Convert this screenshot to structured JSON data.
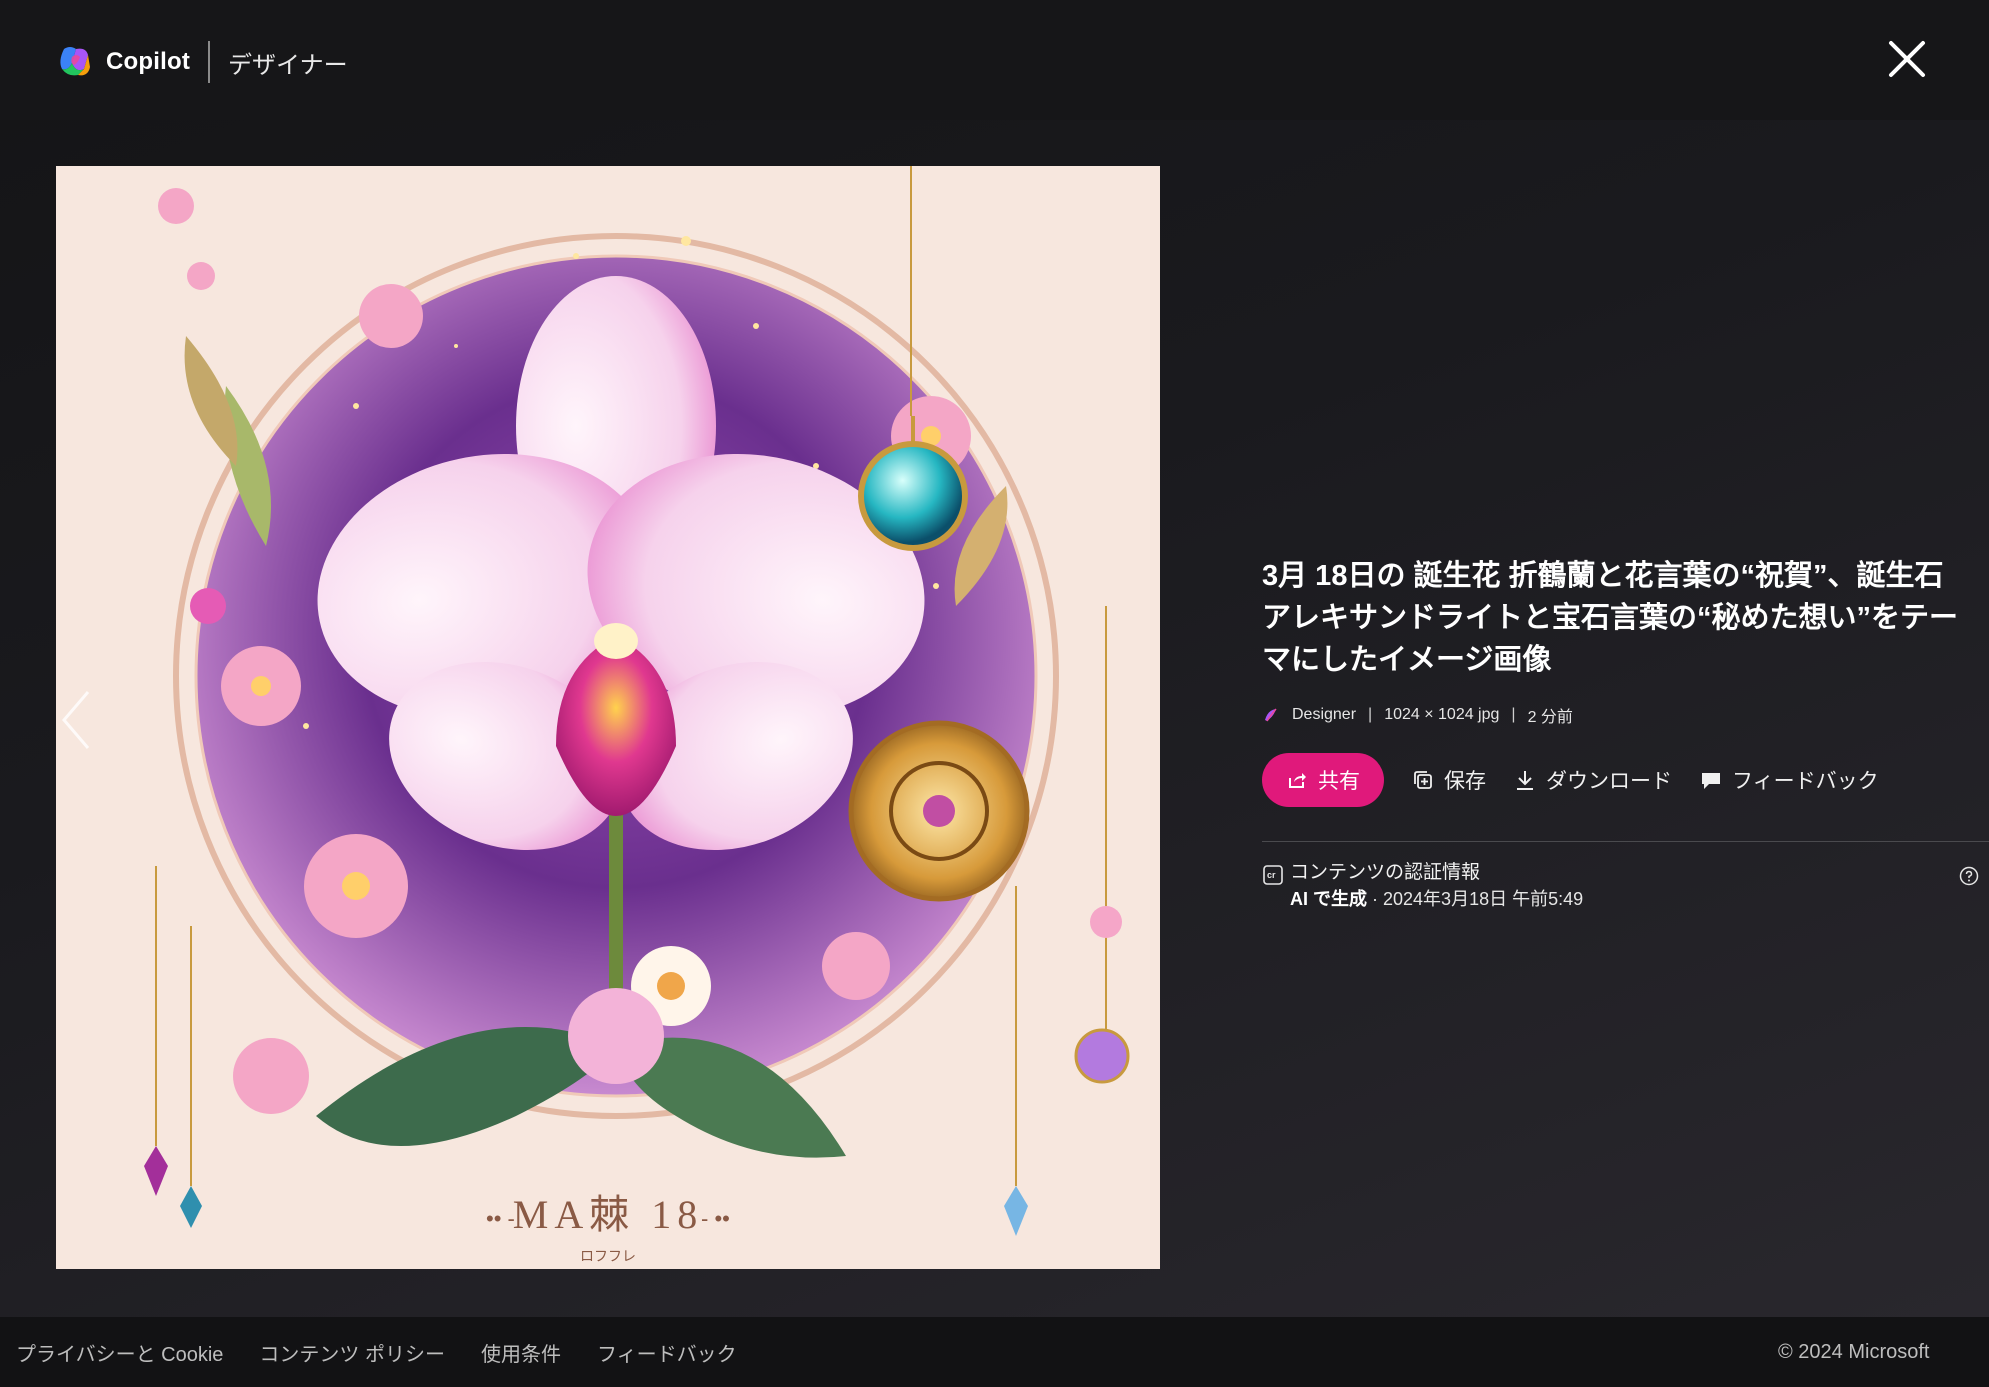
{
  "header": {
    "brand_name": "Copilot",
    "product_name": "デザイナー",
    "close_icon": "close-icon"
  },
  "image": {
    "caption_text": "MA棘 18",
    "caption_sub": "ロフフレ"
  },
  "info": {
    "title": "3月 18日の 誕生花 折鶴蘭と花言葉の“祝賀”、誕生石アレキサンドライトと宝石言葉の“秘めた想い”をテーマにしたイメージ画像",
    "meta": {
      "source": "Designer",
      "size": "1024 × 1024 jpg",
      "age": "2 分前",
      "separator": "|"
    },
    "actions": {
      "share": "共有",
      "save": "保存",
      "download": "ダウンロード",
      "feedback": "フィードバック"
    },
    "credentials": {
      "title": "コンテンツの認証情報",
      "generated": "AI で生成",
      "date": " · 2024年3月18日 午前5:49"
    }
  },
  "footer": {
    "links": [
      "プライバシーと Cookie",
      "コンテンツ ポリシー",
      "使用条件",
      "フィードバック"
    ],
    "copyright": "© 2024 Microsoft"
  },
  "colors": {
    "accent": "#e0197b",
    "background": "#1a1a1e"
  }
}
